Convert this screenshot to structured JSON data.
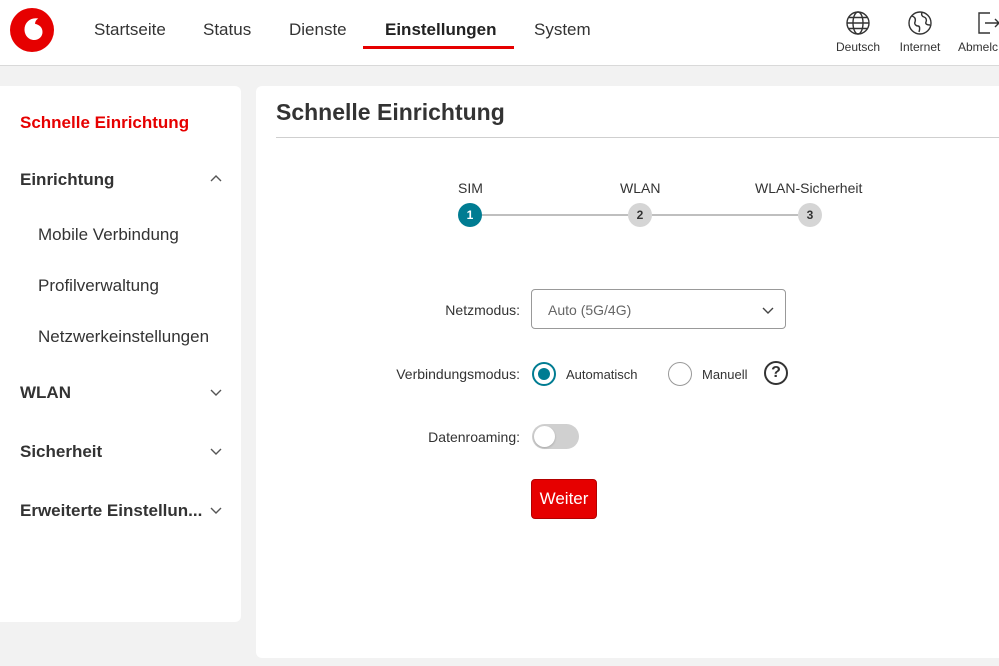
{
  "header": {
    "nav": [
      {
        "label": "Startseite"
      },
      {
        "label": "Status"
      },
      {
        "label": "Dienste"
      },
      {
        "label": "Einstellungen",
        "active": true
      },
      {
        "label": "System"
      }
    ],
    "actions": {
      "language": "Deutsch",
      "internet": "Internet",
      "logout": "Abmelc"
    }
  },
  "sidebar": {
    "current": "Schnelle Einrichtung",
    "groups": [
      {
        "label": "Einrichtung",
        "expanded": true,
        "items": [
          "Mobile Verbindung",
          "Profilverwaltung",
          "Netzwerkeinstellungen"
        ]
      },
      {
        "label": "WLAN",
        "expanded": false
      },
      {
        "label": "Sicherheit",
        "expanded": false
      },
      {
        "label": "Erweiterte Einstellun...",
        "expanded": false
      }
    ]
  },
  "main": {
    "title": "Schnelle Einrichtung",
    "steps": [
      {
        "label": "SIM",
        "number": "1",
        "active": true
      },
      {
        "label": "WLAN",
        "number": "2",
        "active": false
      },
      {
        "label": "WLAN-Sicherheit",
        "number": "3",
        "active": false
      }
    ],
    "form": {
      "netzmodus_label": "Netzmodus:",
      "netzmodus_value": "Auto (5G/4G)",
      "verbindungsmodus_label": "Verbindungsmodus:",
      "option_auto": "Automatisch",
      "option_manual": "Manuell",
      "selected_mode": "Automatisch",
      "help_symbol": "?",
      "datenroaming_label": "Datenroaming:",
      "datenroaming_enabled": false,
      "submit_label": "Weiter"
    }
  },
  "colors": {
    "brand_red": "#e60000",
    "accent_teal": "#007c92"
  }
}
